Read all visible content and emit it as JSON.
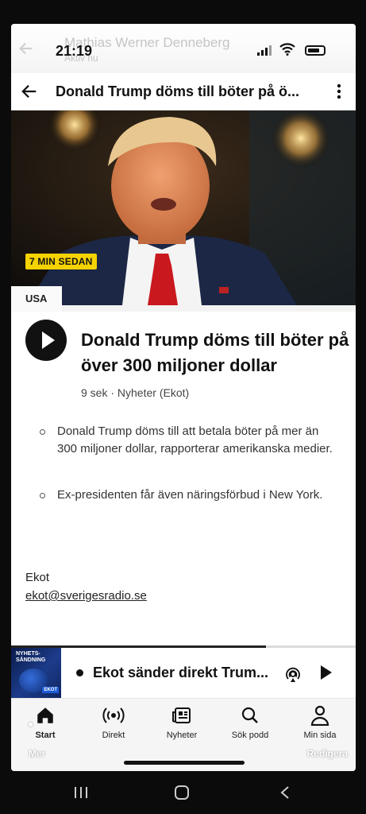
{
  "status_bar": {
    "time": "21:19",
    "overlay_name": "Mathias Werner Denneberg",
    "overlay_sub": "Aktiv nu"
  },
  "app_bar": {
    "title": "Donald Trump döms till böter på ö..."
  },
  "hero": {
    "badge": "7 MIN SEDAN",
    "category": "USA"
  },
  "article": {
    "headline": "Donald Trump döms till böter på över 300 miljoner dollar",
    "meta": "9 sek · Nyheter (Ekot)",
    "bullets": [
      "Donald Trump döms till att betala böter på mer än 300 miljoner dollar, rapporterar amerikanska medier.",
      "Ex-presidenten får även näringsförbud i New York."
    ],
    "source": "Ekot",
    "email": "ekot@sverigesradio.se"
  },
  "mini_player": {
    "thumb_label": "NYHETS-\nSÄNDNING",
    "thumb_logo": "EKOT",
    "title": "Ekot sänder direkt Trum...",
    "progress": 0.74
  },
  "bottom_nav": {
    "items": [
      {
        "label": "Start",
        "icon": "home-icon"
      },
      {
        "label": "Direkt",
        "icon": "broadcast-icon"
      },
      {
        "label": "Nyheter",
        "icon": "news-icon"
      },
      {
        "label": "Sök podd",
        "icon": "search-icon"
      },
      {
        "label": "Min sida",
        "icon": "person-icon"
      }
    ],
    "edge_left": "Mer",
    "edge_right": "Redigera"
  },
  "colors": {
    "badge": "#f5d300",
    "text": "#111111",
    "background": "#f3f3f3"
  }
}
